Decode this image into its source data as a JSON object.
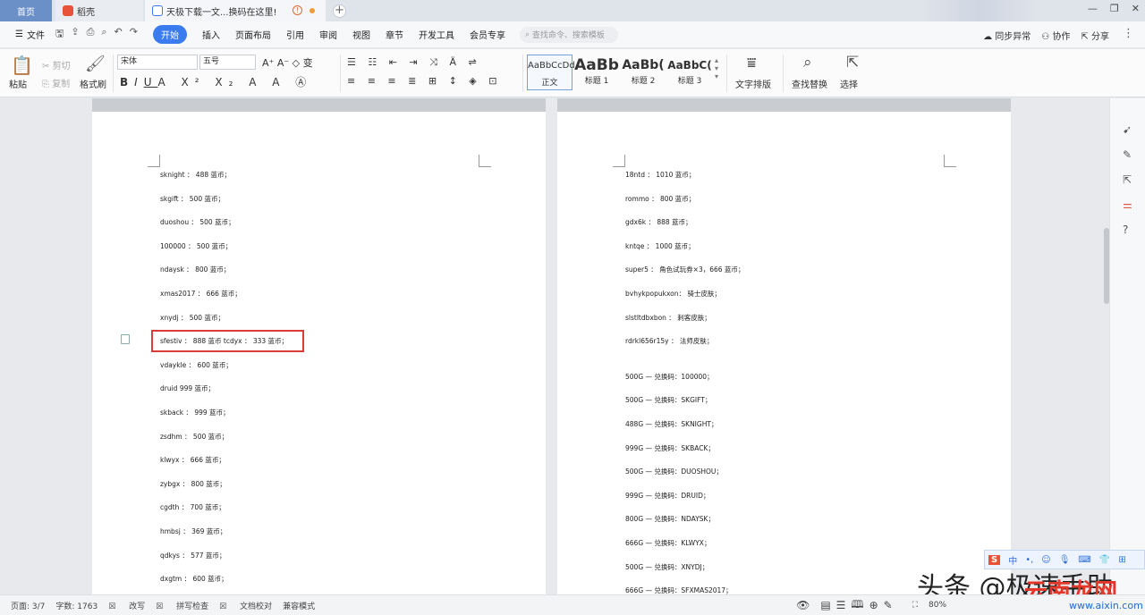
{
  "titlebar": {
    "home": "首页",
    "tab_wps": "稻壳",
    "tab_doc": "天极下载一文...换码在这里!"
  },
  "menu": {
    "file": "文件",
    "items": [
      "开始",
      "插入",
      "页面布局",
      "引用",
      "审阅",
      "视图",
      "章节",
      "开发工具",
      "会员专享"
    ],
    "search_placeholder": "查找命令、搜索模板",
    "sync": "同步异常",
    "collab": "协作",
    "share": "分享"
  },
  "ribbon": {
    "paste": "粘贴",
    "cut": "剪切",
    "copy": "复制",
    "format_painter": "格式刷",
    "font": "宋体",
    "size": "五号",
    "styles": [
      {
        "preview": "AaBbCcDd",
        "label": "正文"
      },
      {
        "preview": "AaBb",
        "label": "标题 1"
      },
      {
        "preview": "AaBb(",
        "label": "标题 2"
      },
      {
        "preview": "AaBbC(",
        "label": "标题 3"
      }
    ],
    "text_layout": "文字排版",
    "find_replace": "查找替换",
    "select": "选择"
  },
  "page1_lines": [
    "sknight ： 488 蓝币；",
    "skgift ： 500 蓝币；",
    "duoshou ： 500 蓝币；",
    "100000 ： 500 蓝币；",
    "ndaysk ： 800 蓝币；",
    "xmas2017 ： 666 蓝币；",
    "xnydj ： 500 蓝币；",
    "sfestiv ： 888 蓝币 tcdyx ： 333 蓝币；",
    "vdaykle ： 600 蓝币；",
    "druid 999 蓝币；",
    "skback ： 999 蓝币；",
    "zsdhm ： 500 蓝币；",
    "klwyx ： 666 蓝币；",
    "zybgx ： 800 蓝币；",
    "cgdth ： 700 蓝币；",
    "hmbsj ： 369 蓝币；",
    "qdkys ： 577 蓝币；",
    "dxgtm ： 600 蓝币；"
  ],
  "page2_lines": [
    "18ntd ： 1010 蓝币；",
    "rommo ： 800 蓝币；",
    "gdx6k ： 888 蓝币；",
    "kntqe ： 1000 蓝币；",
    "super5 ： 角色试玩券×3，666 蓝币；",
    "bvhykpopukxon： 骑士皮肤；",
    "slstltdbxbon ： 刺客皮肤；",
    "rdrkl656r15y ： 法师皮肤；",
    "500G — 兑换码：100000；",
    "500G — 兑换码：SKGIFT；",
    "488G — 兑换码：SKNIGHT；",
    "999G — 兑换码：SKBACK；",
    "500G — 兑换码：DUOSHOU；",
    "999G — 兑换码：DRUID；",
    "800G — 兑换码：NDAYSK；",
    "666G — 兑换码：KLWYX；",
    "500G — 兑换码：XNYDJ；",
    "666G — 兑换码：SFXMAS2017；"
  ],
  "status": {
    "page": "页面: 3/7",
    "words": "字数: 1763",
    "revise": "改写",
    "spell": "拼写检查",
    "proof": "文档校对",
    "compat": "兼容模式",
    "zoom": "80%"
  },
  "ime": {
    "lang": "中"
  },
  "watermark": {
    "text": "头条 @极速手助",
    "red": "云南龙网",
    "url": "www.aixin.com"
  }
}
